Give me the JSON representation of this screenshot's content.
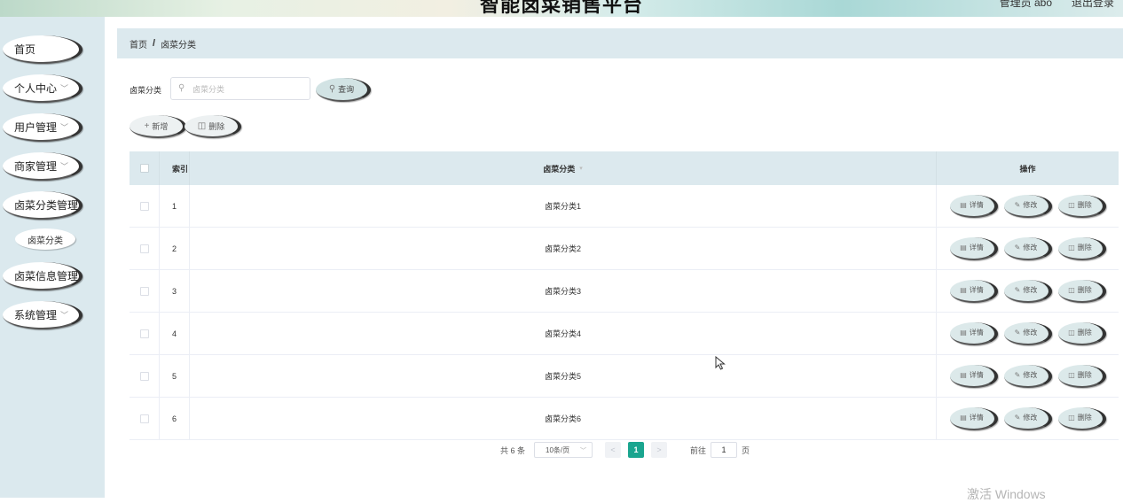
{
  "header": {
    "title": "智能卤菜销售平台",
    "user": "管理员 abo",
    "logout": "退出登录"
  },
  "sidebar": {
    "items": [
      {
        "label": "首页"
      },
      {
        "label": "个人中心"
      },
      {
        "label": "用户管理"
      },
      {
        "label": "商家管理"
      },
      {
        "label": "卤菜分类管理"
      },
      {
        "label": "卤菜信息管理"
      },
      {
        "label": "系统管理"
      }
    ],
    "sub_item": "卤菜分类"
  },
  "breadcrumb": {
    "home": "首页",
    "sep": "/",
    "current": "卤菜分类"
  },
  "search": {
    "label": "卤菜分类",
    "placeholder": "卤菜分类",
    "button": "查询"
  },
  "actions": {
    "add": "新增",
    "delete": "删除"
  },
  "table": {
    "headers": {
      "index": "索引",
      "name": "卤菜分类",
      "ops": "操作"
    },
    "rows": [
      {
        "index": "1",
        "name": "卤菜分类1"
      },
      {
        "index": "2",
        "name": "卤菜分类2"
      },
      {
        "index": "3",
        "name": "卤菜分类3"
      },
      {
        "index": "4",
        "name": "卤菜分类4"
      },
      {
        "index": "5",
        "name": "卤菜分类5"
      },
      {
        "index": "6",
        "name": "卤菜分类6"
      }
    ],
    "row_buttons": {
      "detail": "详情",
      "edit": "修改",
      "delete": "删除"
    }
  },
  "pagination": {
    "total": "共 6 条",
    "page_size": "10条/页",
    "current_page": "1",
    "goto_label": "前往",
    "goto_value": "1",
    "page_suffix": "页",
    "accent_color": "#1aa58f"
  },
  "watermark": "激活 Windows"
}
